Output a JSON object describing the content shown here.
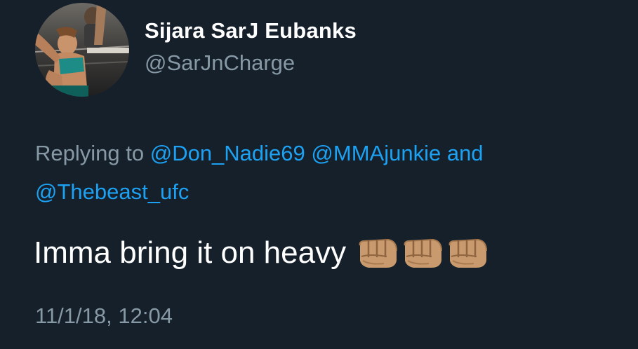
{
  "author": {
    "display_name": "Sijara SarJ Eubanks",
    "handle": "@SarJnCharge"
  },
  "reply": {
    "prefix": "Replying to",
    "mention_1": "@Don_Nadie69",
    "mention_2": "@MMAjunkie",
    "conjunction": "and",
    "mention_3": "@Thebeast_ufc"
  },
  "tweet": {
    "text": "Imma bring it on heavy",
    "emoji": [
      "oncoming-fist-medium-skin-tone-icon",
      "oncoming-fist-medium-skin-tone-icon",
      "oncoming-fist-medium-skin-tone-icon"
    ],
    "timestamp": "11/1/18, 12:04"
  },
  "colors": {
    "background": "#15202b",
    "primary_text": "#ffffff",
    "secondary_text": "#8899a6",
    "link": "#1da1f2"
  }
}
